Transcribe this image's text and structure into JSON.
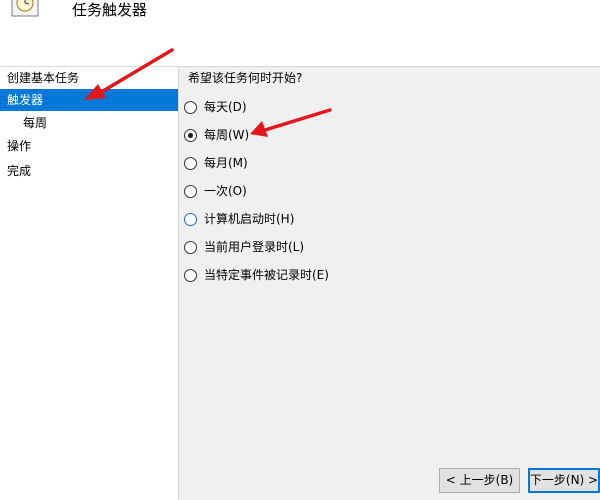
{
  "window": {
    "title": "任务触发器",
    "icon": "task-scheduler-clock-icon"
  },
  "sidebar": {
    "items": [
      {
        "label": "创建基本任务",
        "selected": false,
        "indent": false
      },
      {
        "label": "触发器",
        "selected": true,
        "indent": false
      },
      {
        "label": "每周",
        "selected": false,
        "indent": true
      },
      {
        "label": "操作",
        "selected": false,
        "indent": false
      },
      {
        "label": "完成",
        "selected": false,
        "indent": false
      }
    ]
  },
  "main": {
    "question": "希望该任务何时开始?",
    "options": [
      {
        "label": "每天(D)",
        "checked": false
      },
      {
        "label": "每周(W)",
        "checked": true
      },
      {
        "label": "每月(M)",
        "checked": false
      },
      {
        "label": "一次(O)",
        "checked": false
      },
      {
        "label": "计算机启动时(H)",
        "checked": false
      },
      {
        "label": "当前用户登录时(L)",
        "checked": false
      },
      {
        "label": "当特定事件被记录时(E)",
        "checked": false
      }
    ]
  },
  "footer": {
    "back_label": "< 上一步(B)",
    "next_label": "下一步(N) >"
  },
  "colors": {
    "selection": "#0078d7",
    "annotation_arrow": "#e3161c"
  }
}
